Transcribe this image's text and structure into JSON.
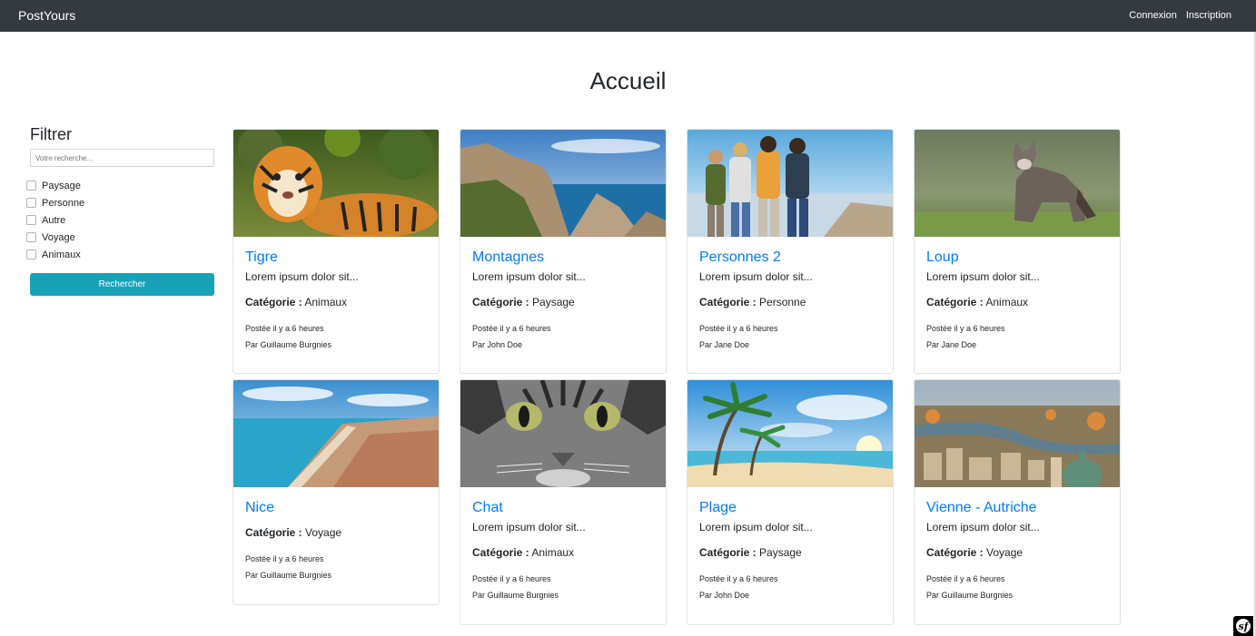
{
  "navbar": {
    "brand": "PostYours",
    "links": [
      {
        "label": "Connexion"
      },
      {
        "label": "Inscription"
      }
    ]
  },
  "page": {
    "title": "Accueil"
  },
  "filter": {
    "title": "Filtrer",
    "search_placeholder": "Votre recherche...",
    "search_value": "",
    "categories": [
      {
        "label": "Paysage",
        "checked": false
      },
      {
        "label": "Personne",
        "checked": false
      },
      {
        "label": "Autre",
        "checked": false
      },
      {
        "label": "Voyage",
        "checked": false
      },
      {
        "label": "Animaux",
        "checked": false
      }
    ],
    "button_label": "Rechercher",
    "button_color": "#17a2b8"
  },
  "category_prefix": "Catégorie :",
  "posts": [
    {
      "title": "Tigre",
      "excerpt": "Lorem ipsum dolor sit...",
      "category": "Animaux",
      "posted": "Postée il y a 6 heures",
      "author": "Par Guillaume Burgnies",
      "image": "tiger-photo"
    },
    {
      "title": "Montagnes",
      "excerpt": "Lorem ipsum dolor sit...",
      "category": "Paysage",
      "posted": "Postée il y a 6 heures",
      "author": "Par John Doe",
      "image": "coastal-cliffs-photo"
    },
    {
      "title": "Personnes 2",
      "excerpt": "Lorem ipsum dolor sit...",
      "category": "Personne",
      "posted": "Postée il y a 6 heures",
      "author": "Par Jane Doe",
      "image": "hikers-photo"
    },
    {
      "title": "Loup",
      "excerpt": "Lorem ipsum dolor sit...",
      "category": "Animaux",
      "posted": "Postée il y a 6 heures",
      "author": "Par Jane Doe",
      "image": "wolf-photo"
    },
    {
      "title": "Nice",
      "excerpt": "",
      "category": "Voyage",
      "posted": "Postée il y a 6 heures",
      "author": "Par Guillaume Burgnies",
      "image": "nice-coast-photo"
    },
    {
      "title": "Chat",
      "excerpt": "Lorem ipsum dolor sit...",
      "category": "Animaux",
      "posted": "Postée il y a 6 heures",
      "author": "Par Guillaume Burgnies",
      "image": "cat-photo"
    },
    {
      "title": "Plage",
      "excerpt": "Lorem ipsum dolor sit...",
      "category": "Paysage",
      "posted": "Postée il y a 6 heures",
      "author": "Par John Doe",
      "image": "beach-photo"
    },
    {
      "title": "Vienne - Autriche",
      "excerpt": "Lorem ipsum dolor sit...",
      "category": "Voyage",
      "posted": "Postée il y a 6 heures",
      "author": "Par Guillaume Burgnies",
      "image": "vienna-city-photo"
    }
  ],
  "colors": {
    "navbar_bg": "#343a40",
    "link_blue": "#007bff",
    "accent_teal": "#17a2b8"
  },
  "debug_toolbar_icon": "symfony-logo-icon"
}
